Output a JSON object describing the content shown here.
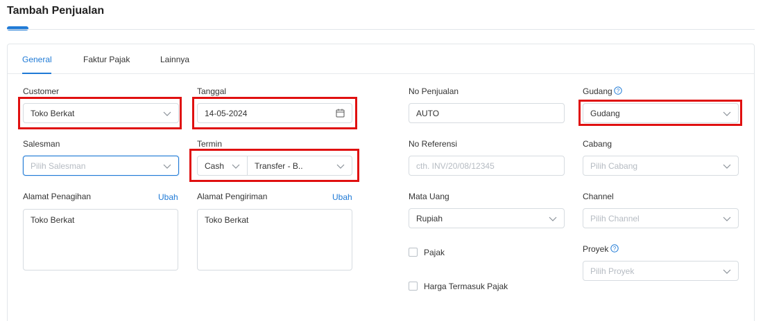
{
  "page": {
    "title": "Tambah Penjualan"
  },
  "tabs": [
    {
      "label": "General",
      "active": true
    },
    {
      "label": "Faktur Pajak",
      "active": false
    },
    {
      "label": "Lainnya",
      "active": false
    }
  ],
  "customer": {
    "label": "Customer",
    "value": "Toko Berkat"
  },
  "tanggal": {
    "label": "Tanggal",
    "value": "14-05-2024"
  },
  "salesman": {
    "label": "Salesman",
    "placeholder": "Pilih Salesman"
  },
  "termin": {
    "label": "Termin",
    "value_left": "Cash",
    "value_right": "Transfer - B.."
  },
  "alamat_penagihan": {
    "label": "Alamat Penagihan",
    "link": "Ubah",
    "value": "Toko Berkat"
  },
  "alamat_pengiriman": {
    "label": "Alamat Pengiriman",
    "link": "Ubah",
    "value": "Toko Berkat"
  },
  "no_penjualan": {
    "label": "No Penjualan",
    "value": "AUTO"
  },
  "no_referensi": {
    "label": "No Referensi",
    "placeholder": "cth. INV/20/08/12345"
  },
  "mata_uang": {
    "label": "Mata Uang",
    "value": "Rupiah"
  },
  "pajak": {
    "label": "Pajak",
    "checked": false
  },
  "harga_termasuk_pajak": {
    "label": "Harga Termasuk Pajak",
    "checked": false
  },
  "gudang": {
    "label": "Gudang",
    "value": "Gudang"
  },
  "cabang": {
    "label": "Cabang",
    "placeholder": "Pilih Cabang"
  },
  "channel": {
    "label": "Channel",
    "placeholder": "Pilih Channel"
  },
  "proyek": {
    "label": "Proyek",
    "placeholder": "Pilih Proyek"
  },
  "colors": {
    "accent": "#1f7ad6",
    "highlight": "#e01010",
    "border": "#d6dbe0"
  },
  "icons": {
    "dropdown": "chevron-down-icon",
    "date": "calendar-icon",
    "help": "help-circle-icon"
  }
}
